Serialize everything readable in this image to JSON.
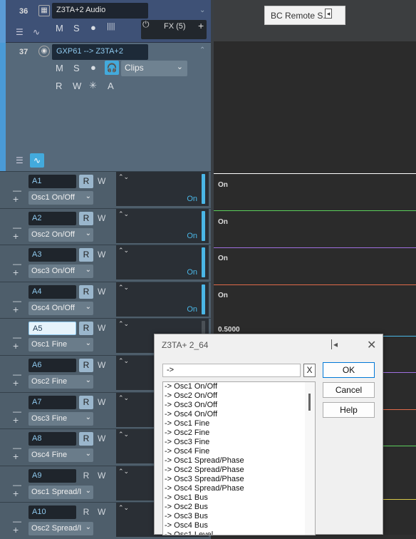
{
  "bc_remote": {
    "label": "BC Remote  S..."
  },
  "track36": {
    "number": "36",
    "name": "Z3TA+2  Audio",
    "m": "M",
    "s": "S",
    "fx_label": "FX (5)"
  },
  "track37": {
    "number": "37",
    "name": "GXP61 --> Z3TA+2",
    "m": "M",
    "s": "S",
    "r": "R",
    "w": "W",
    "a": "A",
    "clips": "Clips"
  },
  "lanes": [
    {
      "name": "A1",
      "param": "Osc1 On/Off",
      "value": "On",
      "r": "R",
      "w": "W"
    },
    {
      "name": "A2",
      "param": "Osc2 On/Off",
      "value": "On",
      "r": "R",
      "w": "W"
    },
    {
      "name": "A3",
      "param": "Osc3 On/Off",
      "value": "On",
      "r": "R",
      "w": "W"
    },
    {
      "name": "A4",
      "param": "Osc4 On/Off",
      "value": "On",
      "r": "R",
      "w": "W"
    },
    {
      "name": "A5",
      "param": "Osc1 Fine",
      "value": "",
      "r": "R",
      "w": "W"
    },
    {
      "name": "A6",
      "param": "Osc2 Fine",
      "value": "",
      "r": "R",
      "w": "W"
    },
    {
      "name": "A7",
      "param": "Osc3 Fine",
      "value": "",
      "r": "R",
      "w": "W"
    },
    {
      "name": "A8",
      "param": "Osc4 Fine",
      "value": "",
      "r": "R",
      "w": "W"
    },
    {
      "name": "A9",
      "param": "Osc1 Spread/I",
      "value": "",
      "r": "R",
      "w": "W"
    },
    {
      "name": "A10",
      "param": "Osc2 Spread/I",
      "value": "",
      "r": "R",
      "w": "W"
    }
  ],
  "right_labels": {
    "l1": "On",
    "l2": "On",
    "l3": "On",
    "l4": "On",
    "l5": "0.5000"
  },
  "colors": {
    "lane1": "#ffffff",
    "lane2": "#5ccf5c",
    "lane3": "#a070e0",
    "lane4": "#e06a4a"
  },
  "dialog": {
    "title": "Z3TA+ 2_64",
    "filter_value": "->",
    "clear_label": "X",
    "ok": "OK",
    "cancel": "Cancel",
    "help": "Help",
    "items": [
      "-> Osc1 On/Off",
      "-> Osc2 On/Off",
      "-> Osc3 On/Off",
      "-> Osc4 On/Off",
      "-> Osc1 Fine",
      "-> Osc2 Fine",
      "-> Osc3 Fine",
      "-> Osc4 Fine",
      "-> Osc1 Spread/Phase",
      "-> Osc2 Spread/Phase",
      "-> Osc3 Spread/Phase",
      "-> Osc4 Spread/Phase",
      "-> Osc1 Bus",
      "-> Osc2 Bus",
      "-> Osc3 Bus",
      "-> Osc4 Bus",
      "-> Osc1 Level"
    ]
  }
}
